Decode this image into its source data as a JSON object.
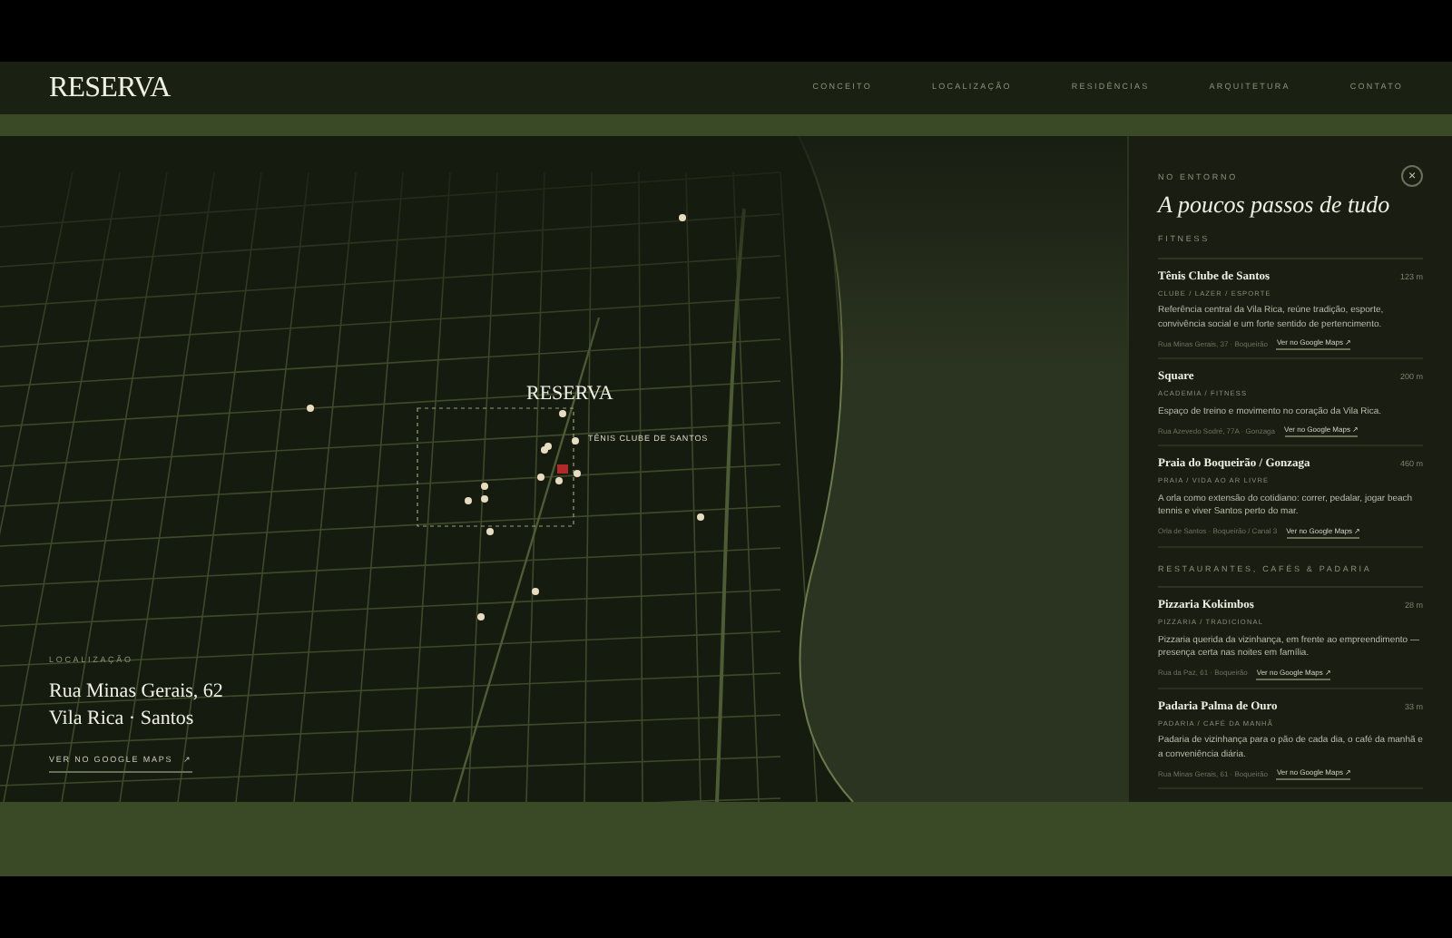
{
  "header": {
    "logo": "RESERVA",
    "nav": [
      {
        "label": "CONCEITO",
        "selected": false
      },
      {
        "label": "LOCALIZAÇÃO",
        "selected": false
      },
      {
        "label": "RESIDÊNCIAS",
        "selected": false
      },
      {
        "label": "ARQUITETURA",
        "selected": false
      },
      {
        "label": "CONTATO",
        "selected": false
      }
    ]
  },
  "map": {
    "logo": "RESERVA",
    "pin_label": "TÊNIS CLUBE DE SANTOS",
    "location": {
      "eyebrow": "LOCALIZAÇÃO",
      "line1": "Rua Minas Gerais, 62",
      "line2": "Vila Rica · Santos",
      "link": "VER NO GOOGLE MAPS",
      "link_icon": "↗"
    }
  },
  "panel": {
    "eyebrow": "NO ENTORNO",
    "title": "A poucos passos de tudo",
    "close": "×",
    "sections": [
      {
        "heading": "FITNESS",
        "items": [
          {
            "name": "Tênis Clube de Santos",
            "distance": "123 m",
            "category": "CLUBE / LAZER / ESPORTE",
            "description": "Referência central da Vila Rica, reúne tradição, esporte, convivência social e um forte sentido de pertencimento.",
            "address": "Rua Minas Gerais, 37 · Boqueirão",
            "link": "Ver no Google Maps ↗"
          },
          {
            "name": "Square",
            "distance": "200 m",
            "category": "ACADEMIA / FITNESS",
            "description": "Espaço de treino e movimento no coração da Vila Rica.",
            "address": "Rua Azevedo Sodré, 77A · Gonzaga",
            "link": "Ver no Google Maps ↗"
          },
          {
            "name": "Praia do Boqueirão / Gonzaga",
            "distance": "460 m",
            "category": "PRAIA / VIDA AO AR LIVRE",
            "description": "A orla como extensão do cotidiano: correr, pedalar, jogar beach tennis e viver Santos perto do mar.",
            "address": "Orla de Santos · Boqueirão / Canal 3",
            "link": "Ver no Google Maps ↗"
          }
        ]
      },
      {
        "heading": "RESTAURANTES, CAFÉS & PADARIA",
        "items": [
          {
            "name": "Pizzaria Kokimbos",
            "distance": "28 m",
            "category": "PIZZARIA / TRADICIONAL",
            "description": "Pizzaria querida da vizinhança, em frente ao empreendimento — presença certa nas noites em família.",
            "address": "Rua da Paz, 61 · Boqueirão",
            "link": "Ver no Google Maps ↗"
          },
          {
            "name": "Padaria Palma de Ouro",
            "distance": "33 m",
            "category": "PADARIA / CAFÉ DA MANHÃ",
            "description": "Padaria de vizinhança para o pão de cada dia, o café da manhã e a conveniência diária.",
            "address": "Rua Minas Gerais, 61 · Boqueirão",
            "link": "Ver no Google Maps ↗"
          }
        ]
      }
    ]
  }
}
